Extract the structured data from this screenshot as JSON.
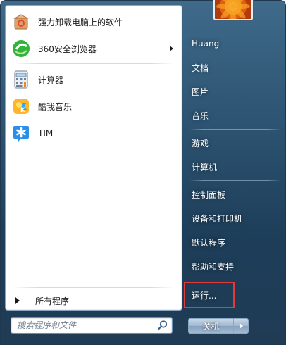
{
  "left_pane": {
    "pinned_items": [
      {
        "label": "强力卸载电脑上的软件",
        "icon": "uninstall-box-icon",
        "has_submenu": false
      },
      {
        "label": "360安全浏览器",
        "icon": "browser-360-icon",
        "has_submenu": true
      }
    ],
    "recent_items": [
      {
        "label": "计算器",
        "icon": "calculator-icon",
        "has_submenu": false
      },
      {
        "label": "酷我音乐",
        "icon": "kuwo-music-icon",
        "has_submenu": false
      },
      {
        "label": "TIM",
        "icon": "tim-icon",
        "has_submenu": false
      }
    ],
    "all_programs": "所有程序",
    "search": {
      "placeholder": "搜索程序和文件",
      "value": ""
    }
  },
  "right_pane": {
    "user_picture": "flower-avatar",
    "groups": [
      [
        "Huang",
        "文档",
        "图片",
        "音乐"
      ],
      [
        "游戏",
        "计算机"
      ],
      [
        "控制面板",
        "设备和打印机",
        "默认程序",
        "帮助和支持"
      ]
    ],
    "run": "运行...",
    "shutdown_label": "关机"
  },
  "colors": {
    "menu_blue": "#2d5472",
    "highlight_red": "#e23b3b",
    "pane_white": "#ffffff"
  }
}
